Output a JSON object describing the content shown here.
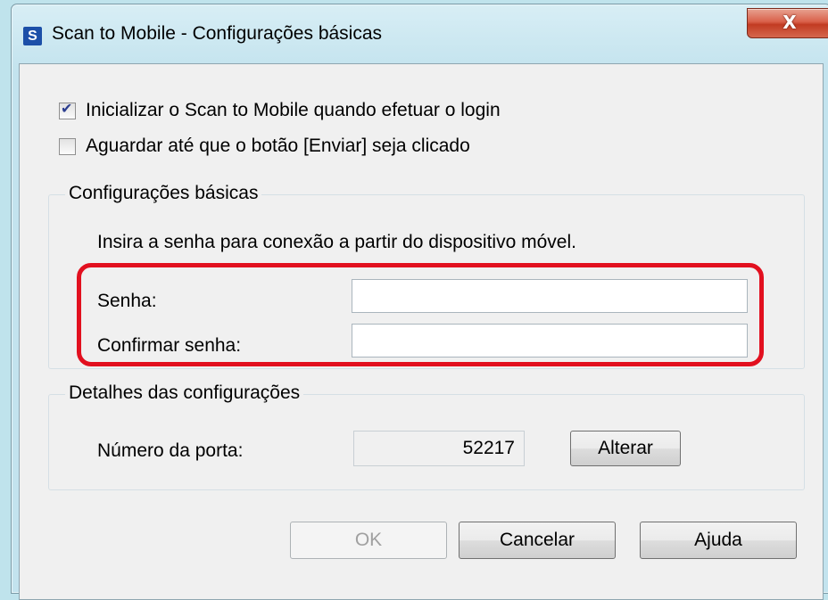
{
  "window": {
    "title": "Scan to Mobile - Configurações básicas",
    "app_icon_glyph": "S",
    "close_glyph": "X",
    "close_color": "#c23b22"
  },
  "options": {
    "autostart": {
      "label": "Inicializar o Scan to Mobile quando efetuar o login",
      "checked": true
    },
    "wait_send": {
      "label": "Aguardar até que o botão [Enviar] seja clicado",
      "checked": false
    }
  },
  "basic_settings": {
    "group_title": "Configurações básicas",
    "instruction": "Insira a senha para conexão a partir do dispositivo móvel.",
    "password_label": "Senha:",
    "password_value": "",
    "confirm_label": "Confirmar senha:",
    "confirm_value": "",
    "highlight_color": "#e2101f"
  },
  "details": {
    "group_title": "Detalhes das configurações",
    "port_label": "Número da porta:",
    "port_value": "52217",
    "change_button": "Alterar"
  },
  "buttons": {
    "ok": "OK",
    "cancel": "Cancelar",
    "help": "Ajuda"
  }
}
